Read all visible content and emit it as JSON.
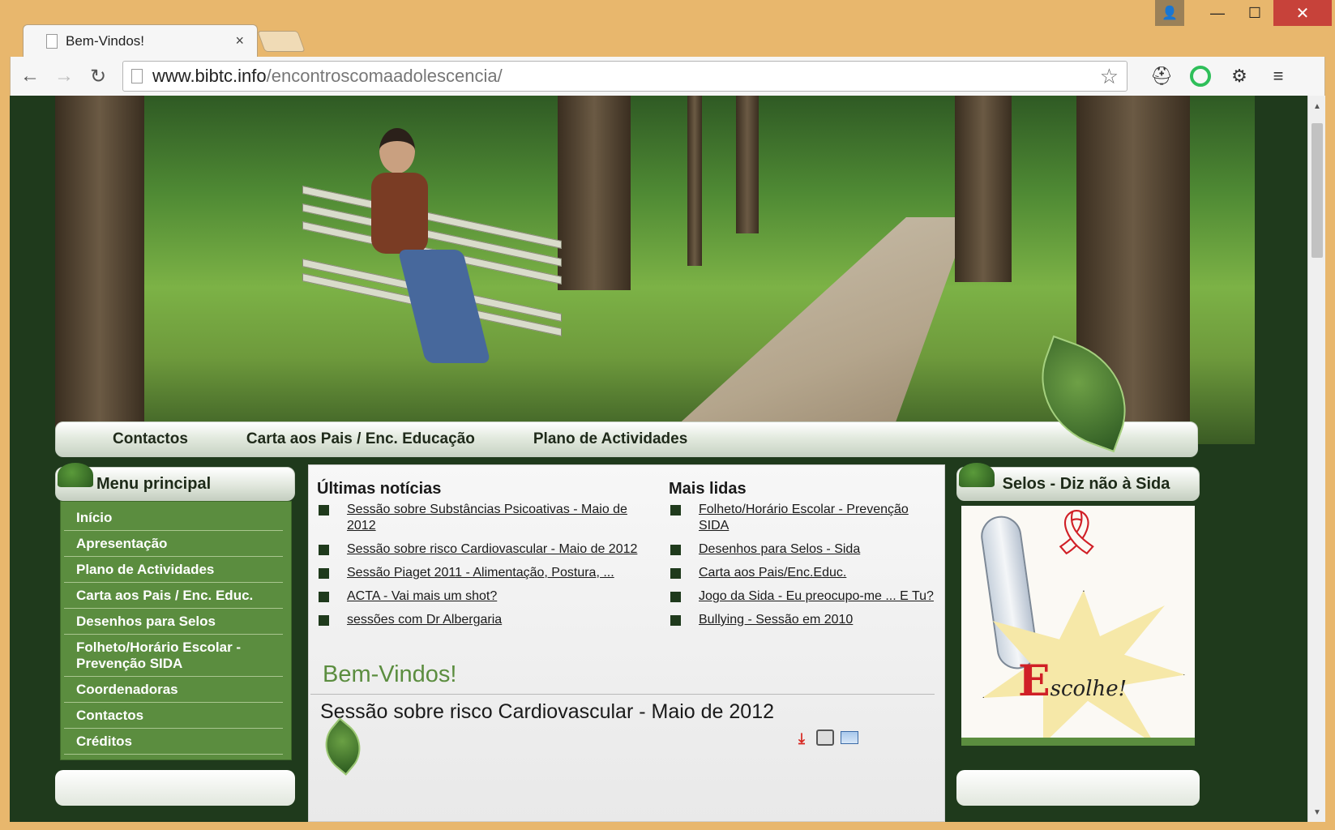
{
  "browser": {
    "tab_title": "Bem-Vindos!",
    "tab_close": "×",
    "url_host": "www.bibtc.info",
    "url_path": "/encontroscomaadolescencia/",
    "back": "←",
    "forward": "→",
    "reload": "↻",
    "star": "☆",
    "menu": "≡",
    "user_icon": "👤",
    "minimize": "—",
    "maximize": "☐",
    "close": "✕"
  },
  "topnav": {
    "items": [
      "Contactos",
      "Carta aos Pais / Enc. Educação",
      "Plano de Actividades"
    ]
  },
  "menu_principal": {
    "title": "Menu principal",
    "items": [
      "Início",
      "Apresentação",
      "Plano de Actividades",
      "Carta aos Pais / Enc. Educ.",
      "Desenhos para Selos",
      "Folheto/Horário Escolar - Prevenção SIDA",
      "Coordenadoras",
      "Contactos",
      "Créditos"
    ]
  },
  "ultimas": {
    "title": "Últimas notícias",
    "items": [
      "Sessão sobre Substâncias Psicoativas - Maio de 2012",
      "Sessão sobre risco Cardiovascular - Maio de 2012",
      "Sessão Piaget 2011 - Alimentação, Postura, ...",
      "ACTA - Vai mais um shot?",
      "sessões com Dr Albergaria"
    ]
  },
  "mais_lidas": {
    "title": "Mais lidas",
    "items": [
      "Folheto/Horário Escolar - Prevenção SIDA",
      "Desenhos para Selos - Sida",
      "Carta aos Pais/Enc.Educ.",
      "Jogo da Sida - Eu preocupo-me ... E Tu?",
      "Bullying - Sessão em 2010"
    ]
  },
  "content": {
    "heading": "Bem-Vindos!",
    "article_title": "Sessão sobre risco Cardiovascular - Maio de 2012",
    "pdf_glyph": "⮯"
  },
  "selos": {
    "title": "Selos - Diz não à Sida",
    "ribbon": "🎗",
    "escolhe_e": "E",
    "escolhe_rest": "scolhe!"
  },
  "colors": {
    "page_bg": "#1f3a1c",
    "menu_green": "#5b8d3f",
    "heading_green": "#5b8d3f",
    "window_frame": "#e8b76d",
    "close_red": "#c7423a"
  }
}
